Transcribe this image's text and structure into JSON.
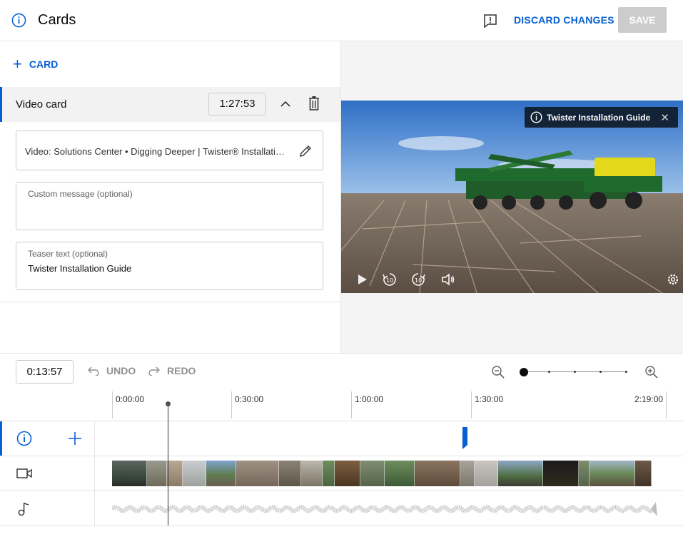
{
  "header": {
    "title": "Cards",
    "discard_label": "DISCARD CHANGES",
    "save_label": "SAVE"
  },
  "left_panel": {
    "add_card_label": "CARD",
    "card": {
      "type_label": "Video card",
      "start_time": "1:27:53",
      "video_field": "Video: Solutions Center • Digging Deeper | Twister® Installation Guide",
      "custom_message_label": "Custom message (optional)",
      "custom_message_value": "",
      "teaser_label": "Teaser text (optional)",
      "teaser_value": "Twister Installation Guide"
    }
  },
  "preview": {
    "teaser_overlay_text": "Twister Installation Guide",
    "controls": [
      "play-icon",
      "rewind-10-icon",
      "forward-10-icon",
      "volume-icon",
      "settings-icon"
    ]
  },
  "timeline": {
    "current_time": "0:13:57",
    "undo_label": "UNDO",
    "redo_label": "REDO",
    "ruler": [
      "0:00:00",
      "0:30:00",
      "1:00:00",
      "1:30:00",
      "2:19:00"
    ],
    "card_marker_time": "1:27:53"
  },
  "colors": {
    "accent": "#065fd4",
    "disabled": "#cccccc",
    "overlay": "#0c141e"
  }
}
